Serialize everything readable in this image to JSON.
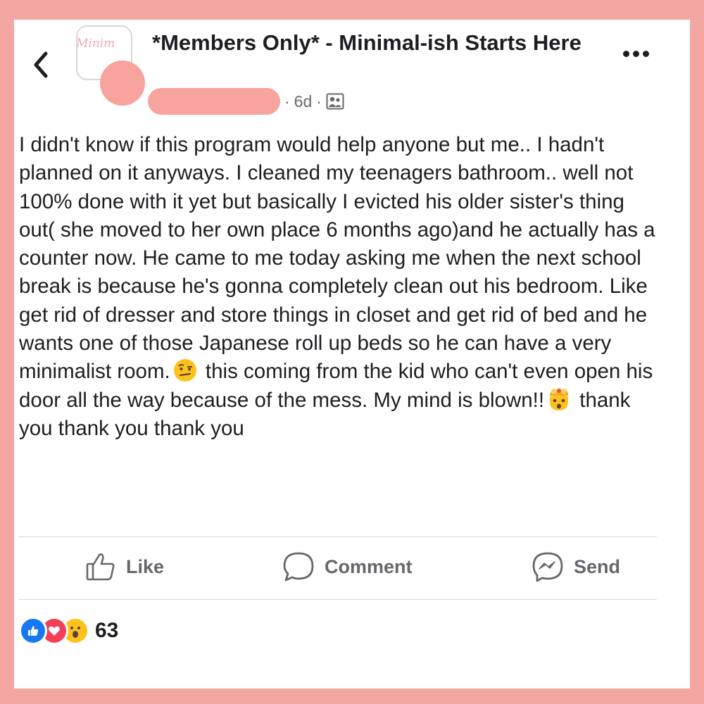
{
  "header": {
    "group_logo_text": "Minim",
    "title": "*Members Only* - Minimal-ish Starts Here",
    "time_ago": "6d",
    "dot": "·",
    "privacy_icon": "group-members-icon",
    "back_icon": "chevron-left-icon",
    "more_icon": "more-options-icon"
  },
  "post": {
    "text_1": "I didn't know if this program would help anyone but me.. I hadn't planned on it anyways. I cleaned my teenagers bathroom.. well not 100% done with it yet but basically I evicted his older sister's thing out( she moved to her own place 6 months ago)and he actually has a counter now. He came to me today asking me when the next school break is because he's gonna completely clean out his bedroom. Like get rid of dresser and store things in closet and get rid of bed and he wants one of those Japanese roll up beds so he can have a very minimalist room.",
    "emoji_1": "face-with-raised-eyebrow",
    "text_2": " this coming from the kid who can't even open his door all the way because of the mess. My mind is blown!!",
    "emoji_2": "exploding-head",
    "text_3": " thank you thank you thank you"
  },
  "actions": {
    "like_label": "Like",
    "comment_label": "Comment",
    "send_label": "Send"
  },
  "reactions": {
    "types": [
      "like",
      "love",
      "wow"
    ],
    "count": "63"
  },
  "colors": {
    "background_frame": "#f4a6a2",
    "redaction": "#f7a39e",
    "like_blue": "#1877f2",
    "love_red": "#f33e58",
    "muted_text": "#65676b"
  }
}
